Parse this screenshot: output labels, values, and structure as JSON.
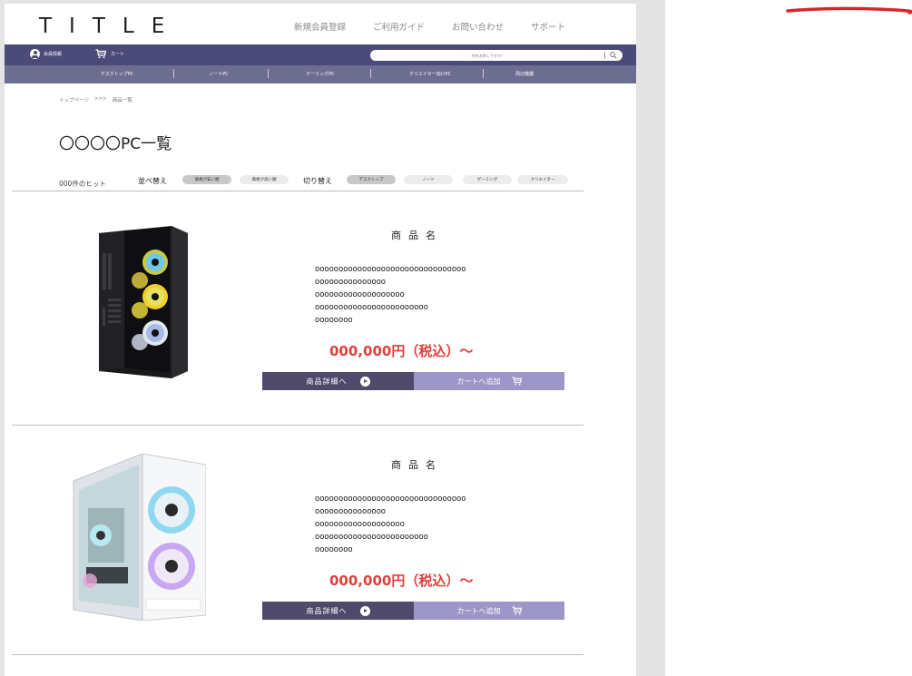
{
  "header": {
    "title": "TITLE",
    "nav": [
      "新規会員登録",
      "ご利用ガイド",
      "お問い合わせ",
      "サポート"
    ]
  },
  "bar": {
    "member_label": "会員情報",
    "cart_label": "カート",
    "search_placeholder": "何をお探しですか？"
  },
  "categories": [
    "デスクトップPC",
    "ノートPC",
    "ゲーミングPC",
    "クリエイター向けPC",
    "周辺機器"
  ],
  "breadcrumb": {
    "home": "トップページ",
    "sep": ">>>",
    "current": "商品一覧"
  },
  "heading": "〇〇〇〇PC一覧",
  "filters": {
    "hits": "000件のヒット",
    "sort_label": "並べ替え",
    "sort_options": [
      "価格が安い順",
      "価格が高い順"
    ],
    "switch_label": "切り替え",
    "switch_options": [
      "デスクトップ",
      "ノート",
      "ゲーミング",
      "クリエイター"
    ]
  },
  "products": [
    {
      "name": "商品名",
      "desc": "oooooooooooooooooooooooooooooooo\nooooooooooooooo\nooooooooooooooooooo\noooooooooooooooooooooooo\noooooooo",
      "price": "000,000円（税込）〜",
      "detail_label": "商品詳細へ",
      "cart_label": "カートへ追加"
    },
    {
      "name": "商品名",
      "desc": "oooooooooooooooooooooooooooooooo\nooooooooooooooo\nooooooooooooooooooo\noooooooooooooooooooooooo\noooooooo",
      "price": "000,000円（税込）〜",
      "detail_label": "商品詳細へ",
      "cart_label": "カートへ追加"
    }
  ],
  "colors": {
    "bar": "#4b4a79",
    "cat_bar": "#6d6d8f",
    "price": "#e0403d",
    "detail_btn": "#4f4a6c",
    "cart_btn": "#9d96c8",
    "annotation": "#d7262c"
  },
  "icons": [
    "user-icon",
    "cart-icon",
    "search-icon",
    "play-icon"
  ]
}
